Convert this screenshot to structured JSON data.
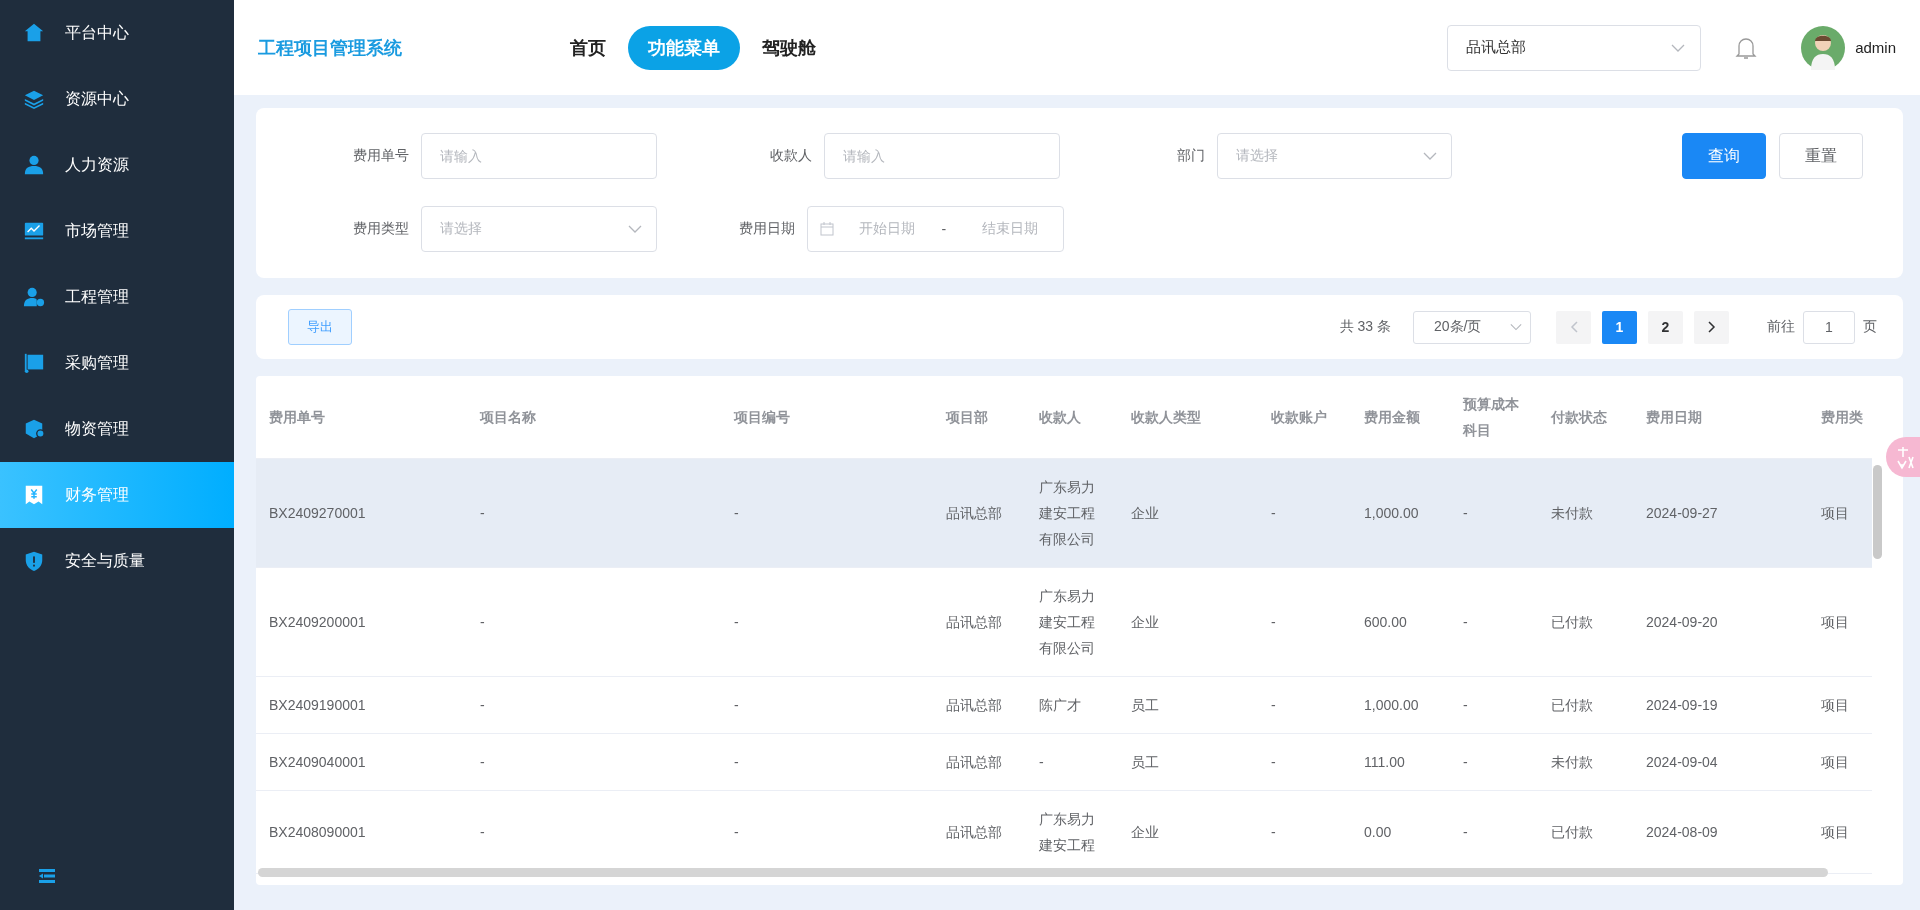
{
  "sidebar": {
    "items": [
      {
        "label": "平台中心",
        "selected": false
      },
      {
        "label": "资源中心",
        "selected": false
      },
      {
        "label": "人力资源",
        "selected": false
      },
      {
        "label": "市场管理",
        "selected": false
      },
      {
        "label": "工程管理",
        "selected": false
      },
      {
        "label": "采购管理",
        "selected": false
      },
      {
        "label": "物资管理",
        "selected": false
      },
      {
        "label": "财务管理",
        "selected": true
      },
      {
        "label": "安全与质量",
        "selected": false
      }
    ]
  },
  "header": {
    "title": "工程项目管理系统",
    "nav": [
      {
        "label": "首页",
        "selected": false
      },
      {
        "label": "功能菜单",
        "selected": true
      },
      {
        "label": "驾驶舱",
        "selected": false
      }
    ],
    "org_select": {
      "value": "品讯总部"
    },
    "user": {
      "name": "admin"
    }
  },
  "filters": {
    "fields": [
      {
        "label": "费用单号",
        "kind": "input",
        "placeholder": "请输入"
      },
      {
        "label": "收款人",
        "kind": "input",
        "placeholder": "请输入"
      },
      {
        "label": "部门",
        "kind": "select",
        "placeholder": "请选择"
      },
      {
        "label": "费用类型",
        "kind": "select",
        "placeholder": "请选择"
      },
      {
        "label": "费用日期",
        "kind": "daterange",
        "start_placeholder": "开始日期",
        "separator": "-",
        "end_placeholder": "结束日期"
      }
    ],
    "buttons": [
      {
        "label": "查询",
        "kind": "primary"
      },
      {
        "label": "重置",
        "kind": "default"
      }
    ]
  },
  "toolbar": {
    "export_button": "导出",
    "total": "共 33 条",
    "page_size": "20条/页",
    "pages": [
      {
        "label": "1",
        "selected": true
      },
      {
        "label": "2",
        "selected": false
      }
    ],
    "goto_label": "前往",
    "goto_value": "1",
    "goto_suffix": "页"
  },
  "table": {
    "columns": [
      "费用单号",
      "项目名称",
      "项目编号",
      "项目部",
      "收款人",
      "收款人类型",
      "收款账户",
      "费用金额",
      "预算成本科目",
      "付款状态",
      "费用日期",
      "费用类"
    ],
    "rows": [
      {
        "selected": true,
        "cells": [
          "BX2409270001",
          "-",
          "-",
          "品讯总部",
          "广东易力建安工程有限公司",
          "企业",
          "-",
          "1,000.00",
          "-",
          "未付款",
          "2024-09-27",
          "项目"
        ]
      },
      {
        "selected": false,
        "cells": [
          "BX2409200001",
          "-",
          "-",
          "品讯总部",
          "广东易力建安工程有限公司",
          "企业",
          "-",
          "600.00",
          "-",
          "已付款",
          "2024-09-20",
          "项目"
        ]
      },
      {
        "selected": false,
        "cells": [
          "BX2409190001",
          "-",
          "-",
          "品讯总部",
          "陈广才",
          "员工",
          "-",
          "1,000.00",
          "-",
          "已付款",
          "2024-09-19",
          "项目"
        ]
      },
      {
        "selected": false,
        "cells": [
          "BX2409040001",
          "-",
          "-",
          "品讯总部",
          "-",
          "员工",
          "-",
          "111.00",
          "-",
          "未付款",
          "2024-09-04",
          "项目"
        ]
      },
      {
        "selected": false,
        "cells": [
          "BX2408090001",
          "-",
          "-",
          "品讯总部",
          "广东易力建安工程",
          "企业",
          "-",
          "0.00",
          "-",
          "已付款",
          "2024-08-09",
          "项目"
        ]
      }
    ]
  }
}
